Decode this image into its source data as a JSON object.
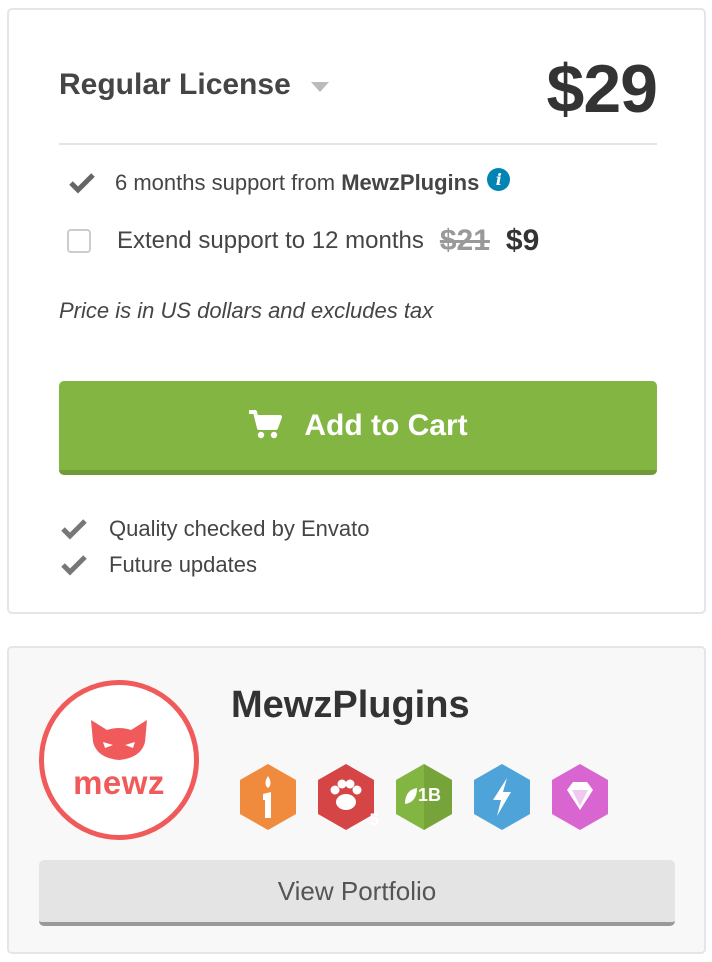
{
  "license": {
    "name": "Regular License",
    "price": "$29"
  },
  "support": {
    "text_prefix": "6 months support from ",
    "author": "MewzPlugins",
    "info_icon": "info-icon"
  },
  "extend": {
    "label": "Extend support to 12 months",
    "old_price": "$21",
    "new_price": "$9",
    "checked": false
  },
  "tax_note": "Price is in US dollars and excludes tax",
  "cart_button": {
    "label": "Add to Cart",
    "icon": "cart-icon",
    "color": "#82b541"
  },
  "features": [
    "Quality checked by Envato",
    "Future updates"
  ],
  "author": {
    "name": "MewzPlugins",
    "avatar_text": "mewz",
    "avatar_color": "#f05a5a",
    "badges": [
      {
        "icon": "candle-icon",
        "color": "#f08a3c",
        "label": ""
      },
      {
        "icon": "paw-icon",
        "color": "#d64545",
        "label": "5"
      },
      {
        "icon": "leaf-1b-icon",
        "color": "#82b541",
        "label": "1B"
      },
      {
        "icon": "lightning-icon",
        "color": "#4ea3d8",
        "label": ""
      },
      {
        "icon": "diamond-icon",
        "color": "#d865d0",
        "label": ""
      }
    ],
    "portfolio_label": "View Portfolio"
  }
}
